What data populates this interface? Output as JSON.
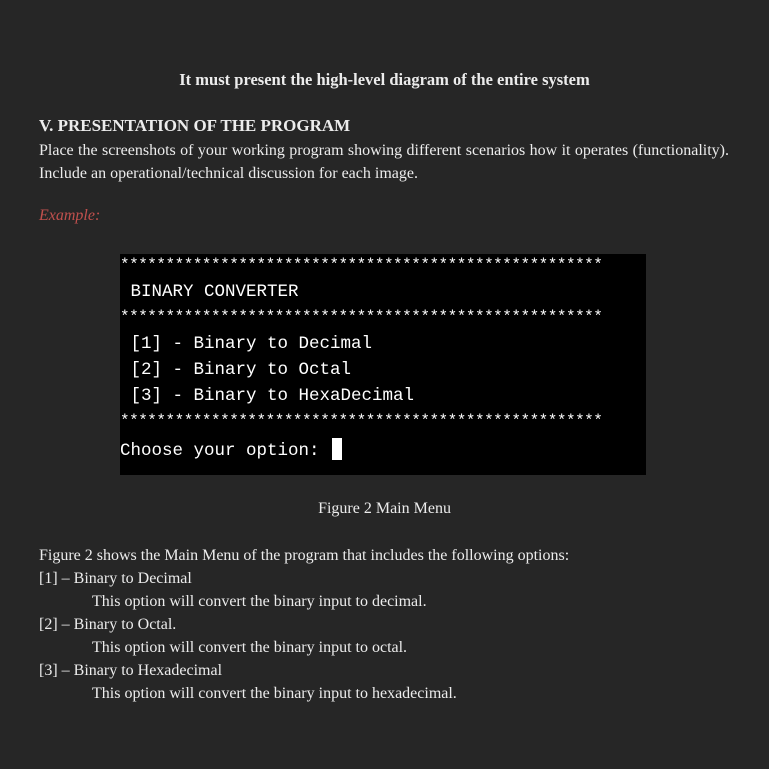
{
  "top_line": "It must present the high-level diagram of the entire system",
  "section": {
    "heading": "V. PRESENTATION OF THE PROGRAM",
    "intro": "Place the screenshots of your working program showing different scenarios how it operates (functionality). Include an operational/technical discussion for each image.",
    "example_label": "Example:"
  },
  "terminal": {
    "stars": "*****************************************************",
    "title": " BINARY CONVERTER",
    "options": [
      " [1] - Binary to Decimal",
      " [2] - Binary to Octal",
      " [3] - Binary to HexaDecimal"
    ],
    "prompt": "Choose your option: "
  },
  "figure_caption": "Figure 2 Main Menu",
  "discussion": {
    "lead": "Figure 2 shows the Main Menu of the program that includes the following options:",
    "items": [
      {
        "option": "[1] – Binary to Decimal",
        "description": "This option will convert the binary input to decimal."
      },
      {
        "option": "[2] – Binary to Octal.",
        "description": "This option will convert the binary input to octal."
      },
      {
        "option": "[3] – Binary to Hexadecimal",
        "description": "This option will convert the binary input to hexadecimal."
      }
    ]
  },
  "colors": {
    "background": "#262626",
    "text": "#ececec",
    "example": "#c0504d",
    "terminal_bg": "#000000"
  }
}
